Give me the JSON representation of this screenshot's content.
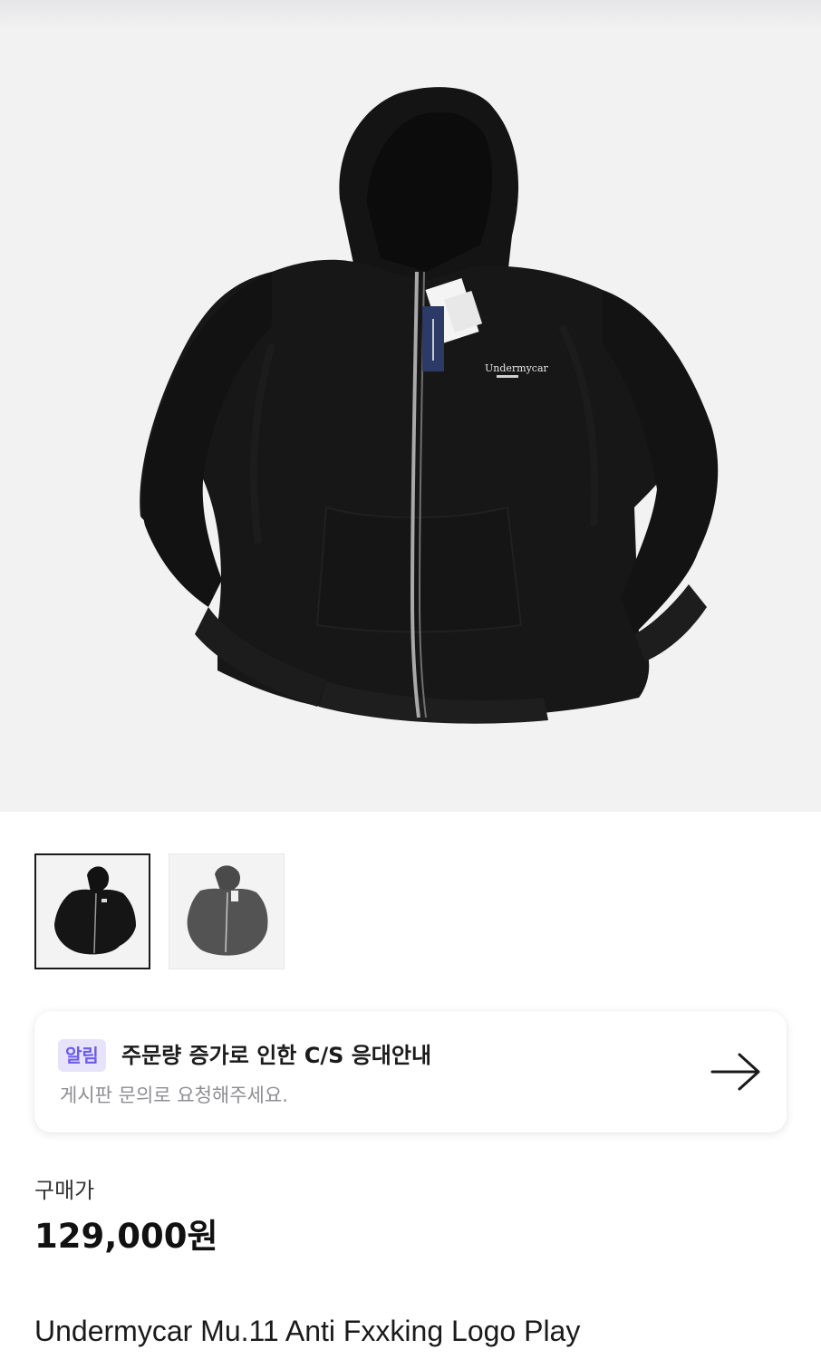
{
  "product": {
    "image": {
      "main_alt": "black-zip-hoodie",
      "logo_text": "Undermycar"
    },
    "thumbnails": [
      {
        "name": "black-hoodie",
        "color": "#151515",
        "selected": true
      },
      {
        "name": "charcoal-hoodie",
        "color": "#505050",
        "selected": false
      }
    ],
    "notice": {
      "badge": "알림",
      "title": "주문량 증가로 인한 C/S 응대안내",
      "subtitle": "게시판 문의로 요청해주세요.",
      "arrow_icon": "arrow-right-icon"
    },
    "price_label": "구매가",
    "price": "129,000원",
    "name": "Undermycar Mu.11 Anti Fxxking Logo Play"
  },
  "colors": {
    "accent": "#6b5ce7",
    "badge_bg": "#e6e3fb",
    "hero_bg": "#f2f2f3"
  }
}
